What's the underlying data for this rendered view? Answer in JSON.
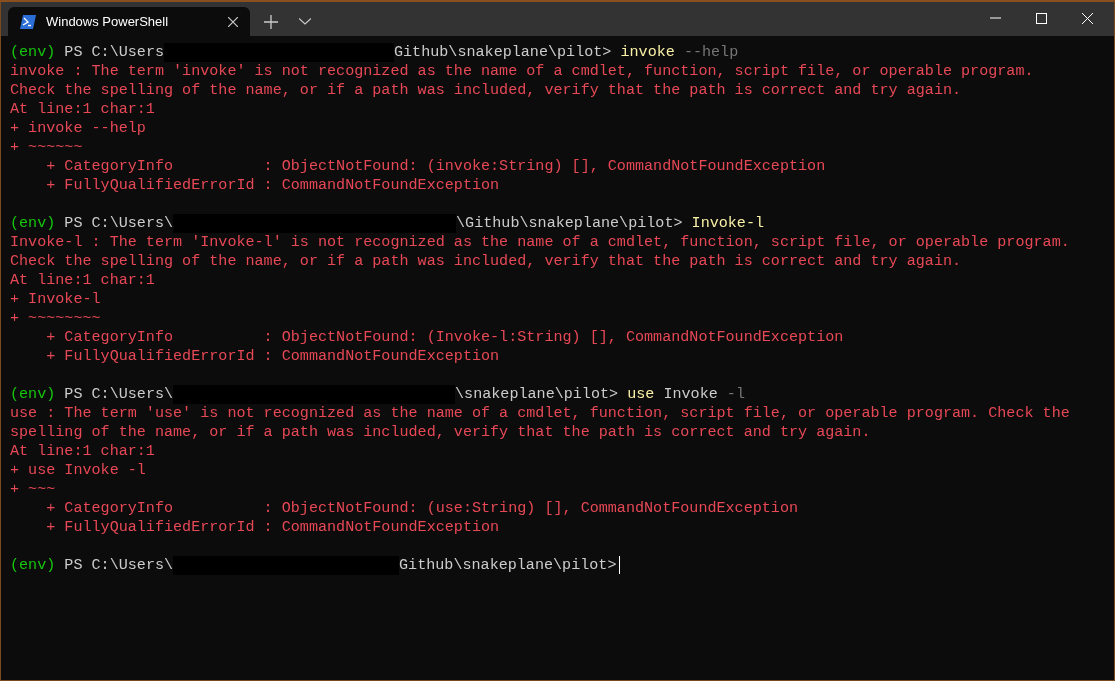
{
  "window": {
    "tabs": [
      {
        "title": "Windows PowerShell",
        "selected": true
      }
    ]
  },
  "terminal": {
    "blocks": [
      {
        "prompt": {
          "env": "(env)",
          "path_before": "PS C:\\Users",
          "path_after": "Github\\snakeplane\\pilot>",
          "command": [
            {
              "kind": "command",
              "text": "invoke"
            },
            {
              "kind": "parameter",
              "text": "--help"
            }
          ]
        },
        "output": [
          "invoke : The term 'invoke' is not recognized as the name of a cmdlet, function, script file, or operable program.",
          "Check the spelling of the name, or if a path was included, verify that the path is correct and try again.",
          "At line:1 char:1",
          "+ invoke --help",
          "+ ~~~~~~",
          "    + CategoryInfo          : ObjectNotFound: (invoke:String) [], CommandNotFoundException",
          "    + FullyQualifiedErrorId : CommandNotFoundException"
        ]
      },
      {
        "prompt": {
          "env": "(env)",
          "path_before": "PS C:\\Users\\",
          "path_after": "\\Github\\snakeplane\\pilot>",
          "command": [
            {
              "kind": "command",
              "text": "Invoke-l"
            }
          ]
        },
        "output": [
          "Invoke-l : The term 'Invoke-l' is not recognized as the name of a cmdlet, function, script file, or operable program.",
          "Check the spelling of the name, or if a path was included, verify that the path is correct and try again.",
          "At line:1 char:1",
          "+ Invoke-l",
          "+ ~~~~~~~~",
          "    + CategoryInfo          : ObjectNotFound: (Invoke-l:String) [], CommandNotFoundException",
          "    + FullyQualifiedErrorId : CommandNotFoundException"
        ]
      },
      {
        "prompt": {
          "env": "(env)",
          "path_before": "PS C:\\Users\\",
          "path_after": "\\snakeplane\\pilot>",
          "command": [
            {
              "kind": "command",
              "text": "use"
            },
            {
              "kind": "argument",
              "text": "Invoke"
            },
            {
              "kind": "parameter",
              "text": "-l"
            }
          ]
        },
        "output": [
          "use : The term 'use' is not recognized as the name of a cmdlet, function, script file, or operable program. Check the",
          "spelling of the name, or if a path was included, verify that the path is correct and try again.",
          "At line:1 char:1",
          "+ use Invoke -l",
          "+ ~~~",
          "    + CategoryInfo          : ObjectNotFound: (use:String) [], CommandNotFoundException",
          "    + FullyQualifiedErrorId : CommandNotFoundException"
        ]
      },
      {
        "prompt": {
          "env": "(env)",
          "path_before": "PS C:\\Users\\",
          "path_after": "Github\\snakeplane\\pilot>"
        },
        "cursor": true
      }
    ]
  }
}
